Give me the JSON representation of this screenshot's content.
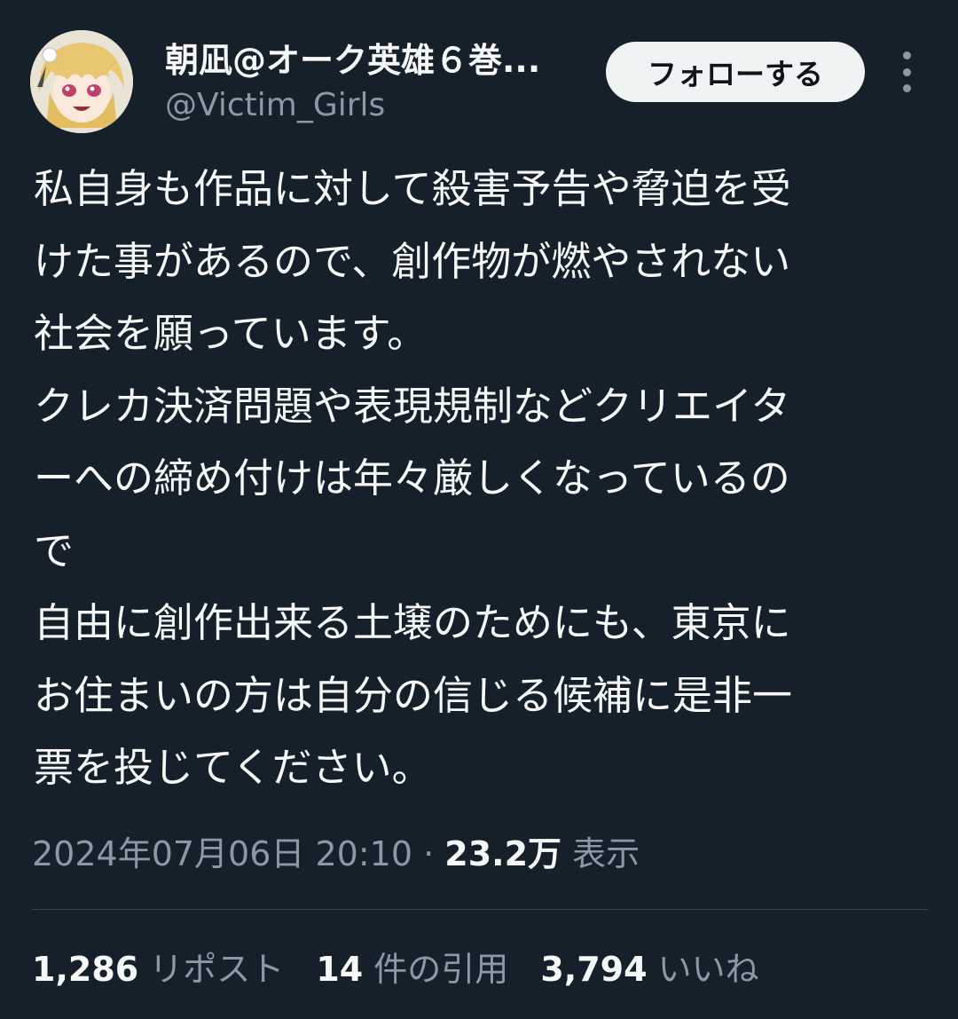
{
  "user": {
    "display_name": "朝凪@オーク英雄６巻...",
    "handle": "@Victim_Girls"
  },
  "follow_button": "フォローする",
  "more_icon": "more-vertical-icon",
  "tweet": {
    "lines": [
      "私自身も作品に対して殺害予告や脅迫を受",
      "けた事があるので、創作物が燃やされない",
      "社会を願っています。",
      "クレカ決済問題や表現規制などクリエイタ",
      "ーへの締め付けは年々厳しくなっているの",
      "で",
      "自由に創作出来る土壌のためにも、東京に",
      "お住まいの方は自分の信じる候補に是非一",
      "票を投じてください。"
    ]
  },
  "meta": {
    "timestamp": "2024年07月06日 20:10",
    "separator": " · ",
    "views_count": "23.2万",
    "views_label": "表示"
  },
  "stats": {
    "reposts_count": "1,286",
    "reposts_label": "リポスト",
    "quotes_count": "14",
    "quotes_label": "件の引用",
    "likes_count": "3,794",
    "likes_label": "いいね"
  },
  "colors": {
    "background": "#15202b",
    "text": "#f7f9f9",
    "secondary": "#8b98a5",
    "divider": "#38444d",
    "button_bg": "#eff3f4"
  }
}
